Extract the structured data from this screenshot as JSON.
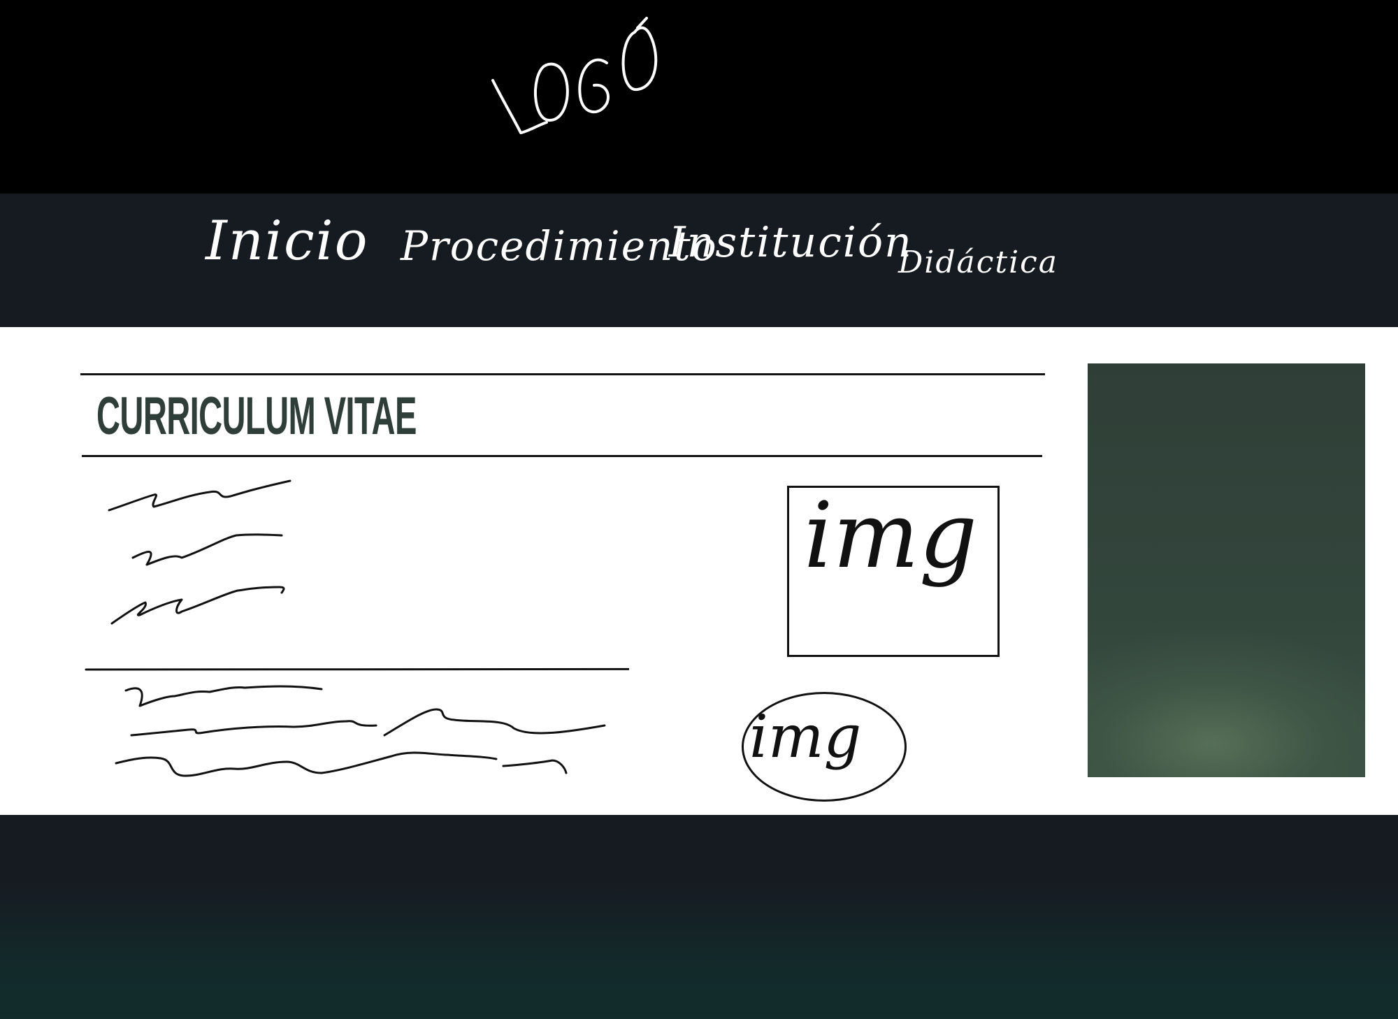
{
  "header": {
    "logo_text": "LOGO"
  },
  "nav": {
    "items": [
      {
        "label": "Inicio"
      },
      {
        "label": "Procedimiento"
      },
      {
        "label": "Institución"
      },
      {
        "label": "Didáctica"
      }
    ]
  },
  "main": {
    "title": "CURRICULUM VITAE",
    "image_box_label": "img",
    "image_circle_label": "img"
  },
  "colors": {
    "header_bg": "#000000",
    "nav_bg": "#161a21",
    "content_bg": "#ffffff",
    "title_color": "#2f3e38",
    "side_panel": "#33463c",
    "footer_bottom": "#122d2c"
  }
}
